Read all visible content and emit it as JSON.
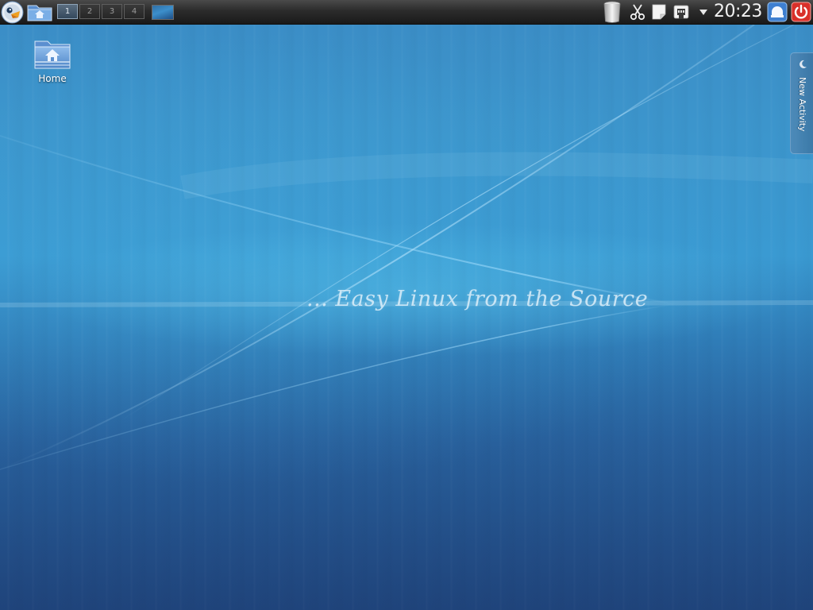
{
  "panel": {
    "pager": {
      "desktops": [
        "1",
        "2",
        "3",
        "4"
      ],
      "active": "1"
    },
    "clock": "20:23",
    "icons": {
      "launcher": "kickoff-launcher-icon",
      "home": "home-folder-icon",
      "trash": "trash-can-icon",
      "clipboard": "scissors-icon",
      "notes": "note-icon",
      "network": "network-icon",
      "lock": "lock-screen-icon",
      "logout": "power-icon"
    }
  },
  "desktop": {
    "icons": [
      {
        "label": "Home"
      }
    ],
    "wallpaper_text": "... Easy Linux from the Source",
    "activity_tab": {
      "label": "New Activity"
    }
  },
  "colors": {
    "panel": "#222222",
    "wallpaper_top": "#3b8cc5",
    "wallpaper_bottom": "#234d86",
    "logout_red": "#d9302a",
    "lock_blue": "#3e7fd0"
  }
}
